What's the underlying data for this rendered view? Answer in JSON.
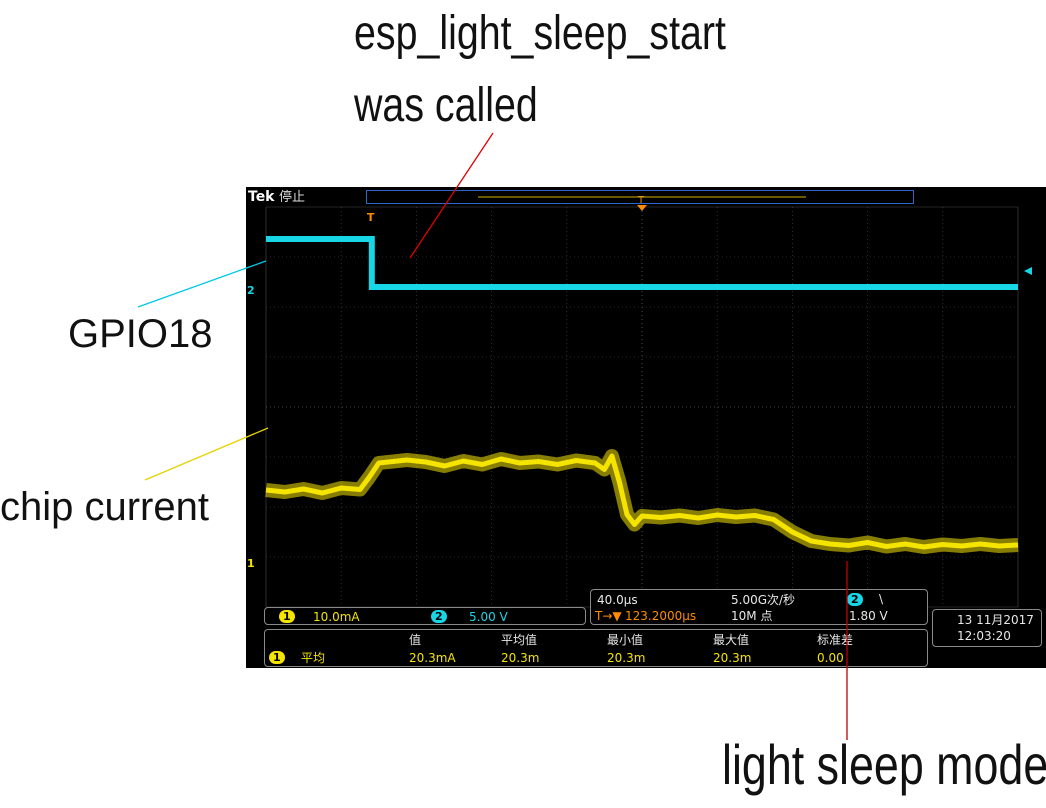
{
  "annotations": {
    "esp_line1": "esp_light_sleep_start",
    "esp_line2": "was called",
    "gpio": "GPIO18",
    "chip": "chip current",
    "light_sleep": "light sleep mode",
    "line_colors": {
      "esp": "#e00000",
      "gpio": "#00c8e6",
      "chip": "#e6d200",
      "light_sleep": "#c00000"
    }
  },
  "scope": {
    "brand": "Tek",
    "state": "停止",
    "trigger_marker": "T",
    "ch1_marker": "1",
    "ch2_marker": "2",
    "ch1_scale_num": "1",
    "ch1_scale": "10.0mA",
    "ch2_scale_num": "2",
    "ch2_scale": "5.00 V",
    "timebase": "40.0μs",
    "sample_rate": "5.00G次/秒",
    "trig_delay_icon": "T→▼",
    "trig_delay": "123.2000μs",
    "record_length": "10M 点",
    "trig_channel": "2",
    "trig_slope": "\\",
    "trig_level": "1.80 V",
    "date": "13 11月2017",
    "time": "12:03:20",
    "measure": {
      "headers": [
        "值",
        "平均值",
        "最小值",
        "最大值",
        "标准差"
      ],
      "row_channel": "1",
      "row_label": "平均",
      "values": [
        "20.3mA",
        "20.3m",
        "20.3m",
        "20.3m",
        "0.00"
      ]
    },
    "colors": {
      "ch1": "#f5e400",
      "ch2": "#17d6e6",
      "grid": "#4a4a4a",
      "trigger": "#ff8c00"
    }
  },
  "chart_data": {
    "type": "line",
    "title": "",
    "xlabel": "",
    "ylabel": "",
    "x_unit": "μs",
    "x_range": [
      0,
      400
    ],
    "series": [
      {
        "name": "GPIO18",
        "unit": "V",
        "x": [
          0,
          56.3,
          56.3,
          400
        ],
        "y": [
          5.0,
          5.0,
          0.2,
          0.2
        ]
      },
      {
        "name": "chip current",
        "unit": "mA",
        "x": [
          0,
          10,
          20,
          30,
          40,
          50,
          55,
          60,
          65,
          75,
          85,
          95,
          105,
          115,
          125,
          135,
          145,
          155,
          165,
          175,
          180,
          184,
          188,
          192,
          196,
          200,
          210,
          220,
          230,
          240,
          250,
          260,
          270,
          280,
          290,
          300,
          310,
          320,
          330,
          340,
          350,
          360,
          370,
          380,
          390,
          400
        ],
        "y": [
          14.4,
          14.0,
          14.6,
          13.8,
          14.8,
          14.5,
          17.0,
          19.8,
          20.0,
          20.4,
          20.0,
          19.2,
          20.2,
          19.5,
          20.6,
          19.8,
          20.1,
          19.5,
          20.3,
          19.8,
          18.5,
          21.2,
          16.0,
          9.5,
          7.5,
          9.2,
          8.9,
          9.3,
          8.8,
          9.4,
          9.0,
          9.3,
          8.5,
          6.0,
          4.2,
          3.6,
          3.3,
          3.9,
          3.1,
          3.6,
          3.0,
          3.5,
          3.2,
          3.6,
          3.2,
          3.4
        ]
      }
    ],
    "grid": true
  }
}
